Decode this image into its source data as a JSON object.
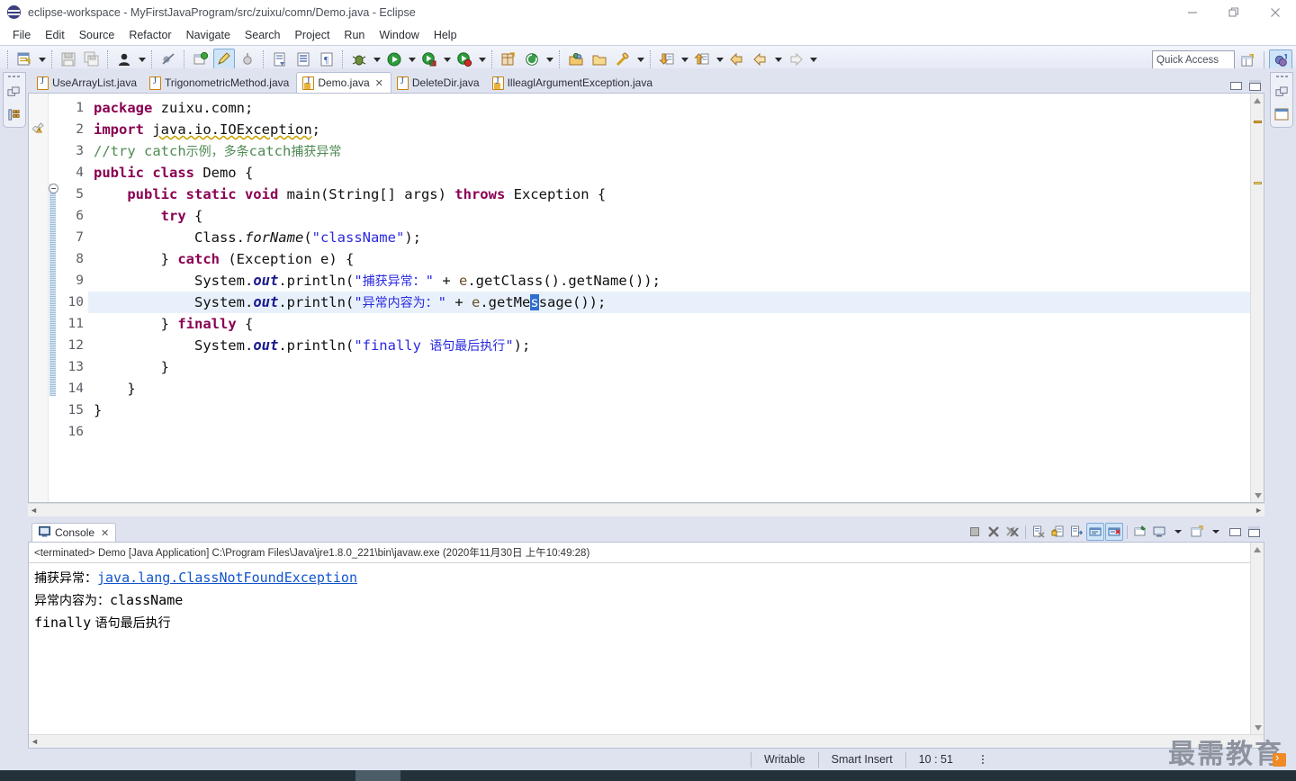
{
  "window": {
    "title": "eclipse-workspace - MyFirstJavaProgram/src/zuixu/comn/Demo.java - Eclipse",
    "icon": "eclipse-icon",
    "controls": {
      "minimize": "minimize-icon",
      "restore": "restore-icon",
      "close": "close-icon"
    }
  },
  "menubar": {
    "items": [
      {
        "label": "File"
      },
      {
        "label": "Edit"
      },
      {
        "label": "Source"
      },
      {
        "label": "Refactor"
      },
      {
        "label": "Navigate"
      },
      {
        "label": "Search"
      },
      {
        "label": "Project"
      },
      {
        "label": "Run"
      },
      {
        "label": "Window"
      },
      {
        "label": "Help"
      }
    ]
  },
  "toolbar": {
    "quick_access_placeholder": "Quick Access",
    "buttons": [
      "new-wizard-icon",
      "save-icon",
      "save-all-icon",
      "user-icon",
      "skip-breakpoints-icon",
      "new-java-package-icon",
      "highlight-icon",
      "toggle-mark-icon",
      "open-type-icon",
      "open-task-icon",
      "paragraph-icon",
      "debug-icon",
      "run-icon",
      "run-external-icon",
      "coverage-icon",
      "new-java-project-icon",
      "new-class-icon",
      "open-perspective-icon",
      "open-folder-icon",
      "search-icon",
      "next-annotation-icon",
      "previous-annotation-icon",
      "back-icon",
      "forward-icon"
    ],
    "perspective_buttons": [
      "open-perspective-icon",
      "java-perspective-icon"
    ]
  },
  "editor": {
    "tabs": [
      {
        "label": "UseArrayList.java",
        "active": false,
        "warning": false,
        "closable": false
      },
      {
        "label": "TrigonometricMethod.java",
        "active": false,
        "warning": false,
        "closable": false
      },
      {
        "label": "Demo.java",
        "active": true,
        "warning": true,
        "closable": true
      },
      {
        "label": "DeleteDir.java",
        "active": false,
        "warning": false,
        "closable": false
      },
      {
        "label": "IlleaglArgumentException.java",
        "active": false,
        "warning": true,
        "closable": false
      }
    ],
    "panel_controls": [
      "minimize-icon",
      "maximize-icon"
    ],
    "line_numbers": [
      "1",
      "2",
      "3",
      "4",
      "5",
      "6",
      "7",
      "8",
      "9",
      "10",
      "11",
      "12",
      "13",
      "14",
      "15",
      "16"
    ],
    "lines": [
      {
        "n": 1,
        "text": "package zuixu.comn;"
      },
      {
        "n": 2,
        "text": "import java.io.IOException;"
      },
      {
        "n": 3,
        "text": "//try catch示例，多条catch捕获异常"
      },
      {
        "n": 4,
        "text": "public class Demo {"
      },
      {
        "n": 5,
        "text": "    public static void main(String[] args) throws Exception {"
      },
      {
        "n": 6,
        "text": "        try {"
      },
      {
        "n": 7,
        "text": "            Class.forName(\"className\");"
      },
      {
        "n": 8,
        "text": "        } catch (Exception e) {"
      },
      {
        "n": 9,
        "text": "            System.out.println(\"捕获异常：\" + e.getClass().getName());"
      },
      {
        "n": 10,
        "text": "            System.out.println(\"异常内容为：\" + e.getMessage());"
      },
      {
        "n": 11,
        "text": "        } finally {"
      },
      {
        "n": 12,
        "text": "            System.out.println(\"finally 语句最后执行\");"
      },
      {
        "n": 13,
        "text": "        }"
      },
      {
        "n": 14,
        "text": "    }"
      },
      {
        "n": 15,
        "text": "}"
      },
      {
        "n": 16,
        "text": ""
      }
    ],
    "current_line": 10,
    "warning_marker_line": 2,
    "selection": "s"
  },
  "console": {
    "tab_label": "Console",
    "tab_icon": "console-icon",
    "close_icon": "close-icon",
    "header": "<terminated> Demo [Java Application] C:\\Program Files\\Java\\jre1.8.0_221\\bin\\javaw.exe (2020年11月30日 上午10:49:28)",
    "output": [
      {
        "prefix": "捕获异常：",
        "link": "java.lang.ClassNotFoundException",
        "suffix": ""
      },
      {
        "prefix": "异常内容为：",
        "link": "",
        "suffix": "className"
      },
      {
        "prefix": "finally",
        "link": "",
        "suffix": " 语句最后执行"
      }
    ],
    "toolbar_buttons": [
      "terminate-icon",
      "remove-launch-icon",
      "remove-all-launches-icon",
      "clear-console-icon",
      "scroll-lock-icon",
      "word-wrap-icon",
      "show-console-on-output-icon",
      "show-console-on-error-icon",
      "pin-console-icon",
      "display-selected-console-icon",
      "open-console-icon",
      "minimize-icon",
      "maximize-icon"
    ]
  },
  "statusbar": {
    "writable": "Writable",
    "insert_mode": "Smart Insert",
    "cursor_position": "10 : 51"
  },
  "watermark": {
    "text": "最需教育"
  },
  "colors": {
    "keyword": "#8a0052",
    "string": "#2a2ae0",
    "comment": "#4f8a52",
    "field": "#1a1a8c",
    "link": "#1155cc",
    "accent": "#cfe4f7",
    "chrome": "#dfe3f0"
  }
}
